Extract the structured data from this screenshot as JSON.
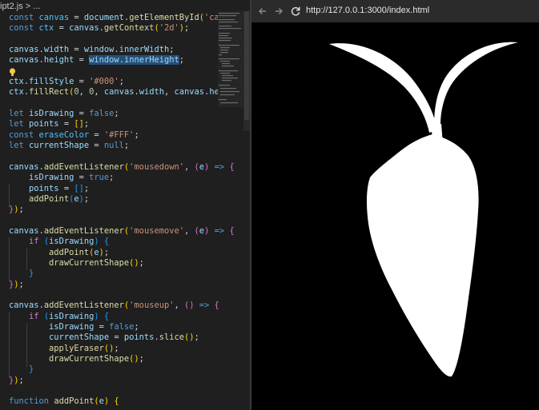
{
  "editor": {
    "breadcrumb": "ipt2.js > ...",
    "code_lines": [
      [
        [
          "kw",
          "const "
        ],
        [
          "cst",
          "canvas"
        ],
        [
          "pun",
          " = "
        ],
        [
          "var",
          "document"
        ],
        [
          "pun",
          "."
        ],
        [
          "fn",
          "getElementById"
        ],
        [
          "b1",
          "("
        ],
        [
          "str",
          "'canvas'"
        ],
        [
          "b1",
          ")"
        ],
        [
          "pun",
          ";"
        ]
      ],
      [
        [
          "kw",
          "const "
        ],
        [
          "cst",
          "ctx"
        ],
        [
          "pun",
          " = "
        ],
        [
          "var",
          "canvas"
        ],
        [
          "pun",
          "."
        ],
        [
          "fn",
          "getContext"
        ],
        [
          "b1",
          "("
        ],
        [
          "str",
          "'2d'"
        ],
        [
          "b1",
          ")"
        ],
        [
          "pun",
          ";"
        ]
      ],
      [],
      [
        [
          "var",
          "canvas"
        ],
        [
          "pun",
          "."
        ],
        [
          "var",
          "width"
        ],
        [
          "pun",
          " = "
        ],
        [
          "var",
          "window"
        ],
        [
          "pun",
          "."
        ],
        [
          "var",
          "innerWidth"
        ],
        [
          "pun",
          ";"
        ]
      ],
      [
        [
          "var",
          "canvas"
        ],
        [
          "pun",
          "."
        ],
        [
          "var",
          "height"
        ],
        [
          "pun",
          " = "
        ],
        [
          "var hl",
          "window"
        ],
        [
          "pun hl",
          "."
        ],
        [
          "var hl",
          "innerHeight"
        ],
        [
          "pun",
          ";"
        ]
      ],
      [],
      [
        [
          "var",
          "ctx"
        ],
        [
          "pun",
          "."
        ],
        [
          "var",
          "fillStyle"
        ],
        [
          "pun",
          " = "
        ],
        [
          "str",
          "'#000'"
        ],
        [
          "pun",
          ";"
        ]
      ],
      [
        [
          "var",
          "ctx"
        ],
        [
          "pun",
          "."
        ],
        [
          "fn",
          "fillRect"
        ],
        [
          "b1",
          "("
        ],
        [
          "num",
          "0"
        ],
        [
          "pun",
          ", "
        ],
        [
          "num",
          "0"
        ],
        [
          "pun",
          ", "
        ],
        [
          "var",
          "canvas"
        ],
        [
          "pun",
          "."
        ],
        [
          "var",
          "width"
        ],
        [
          "pun",
          ", "
        ],
        [
          "var",
          "canvas"
        ],
        [
          "pun",
          "."
        ],
        [
          "var",
          "height"
        ],
        [
          "b1",
          ")"
        ],
        [
          "pun",
          ";"
        ]
      ],
      [],
      [
        [
          "kw",
          "let "
        ],
        [
          "var",
          "isDrawing"
        ],
        [
          "pun",
          " = "
        ],
        [
          "kw",
          "false"
        ],
        [
          "pun",
          ";"
        ]
      ],
      [
        [
          "kw",
          "let "
        ],
        [
          "var",
          "points"
        ],
        [
          "pun",
          " = "
        ],
        [
          "b1",
          "[]"
        ],
        [
          "pun",
          ";"
        ]
      ],
      [
        [
          "kw",
          "const "
        ],
        [
          "cst",
          "eraseColor"
        ],
        [
          "pun",
          " = "
        ],
        [
          "str",
          "'#FFF'"
        ],
        [
          "pun",
          ";"
        ]
      ],
      [
        [
          "kw",
          "let "
        ],
        [
          "var",
          "currentShape"
        ],
        [
          "pun",
          " = "
        ],
        [
          "kw",
          "null"
        ],
        [
          "pun",
          ";"
        ]
      ],
      [],
      [
        [
          "var",
          "canvas"
        ],
        [
          "pun",
          "."
        ],
        [
          "fn",
          "addEventListener"
        ],
        [
          "b1",
          "("
        ],
        [
          "str",
          "'mousedown'"
        ],
        [
          "pun",
          ", "
        ],
        [
          "b2",
          "("
        ],
        [
          "var",
          "e"
        ],
        [
          "b2",
          ")"
        ],
        [
          "kw",
          " => "
        ],
        [
          "b2",
          "{"
        ]
      ],
      [
        [
          "pun",
          "    "
        ],
        [
          "var",
          "isDrawing"
        ],
        [
          "pun",
          " = "
        ],
        [
          "kw",
          "true"
        ],
        [
          "pun",
          ";"
        ]
      ],
      [
        [
          "pun",
          "    "
        ],
        [
          "var",
          "points"
        ],
        [
          "pun",
          " = "
        ],
        [
          "b3",
          "[]"
        ],
        [
          "pun",
          ";"
        ]
      ],
      [
        [
          "pun",
          "    "
        ],
        [
          "fn",
          "addPoint"
        ],
        [
          "b3",
          "("
        ],
        [
          "var",
          "e"
        ],
        [
          "b3",
          ")"
        ],
        [
          "pun",
          ";"
        ]
      ],
      [
        [
          "b2",
          "}"
        ],
        [
          "b1",
          ")"
        ],
        [
          "pun",
          ";"
        ]
      ],
      [],
      [
        [
          "var",
          "canvas"
        ],
        [
          "pun",
          "."
        ],
        [
          "fn",
          "addEventListener"
        ],
        [
          "b1",
          "("
        ],
        [
          "str",
          "'mousemove'"
        ],
        [
          "pun",
          ", "
        ],
        [
          "b2",
          "("
        ],
        [
          "var",
          "e"
        ],
        [
          "b2",
          ")"
        ],
        [
          "kw",
          " => "
        ],
        [
          "b2",
          "{"
        ]
      ],
      [
        [
          "pun",
          "    "
        ],
        [
          "ctl",
          "if "
        ],
        [
          "b3",
          "("
        ],
        [
          "var",
          "isDrawing"
        ],
        [
          "b3",
          ")"
        ],
        [
          "pun",
          " "
        ],
        [
          "b3",
          "{"
        ]
      ],
      [
        [
          "pun",
          "        "
        ],
        [
          "fn",
          "addPoint"
        ],
        [
          "b1",
          "("
        ],
        [
          "var",
          "e"
        ],
        [
          "b1",
          ")"
        ],
        [
          "pun",
          ";"
        ]
      ],
      [
        [
          "pun",
          "        "
        ],
        [
          "fn",
          "drawCurrentShape"
        ],
        [
          "b1",
          "()"
        ],
        [
          "pun",
          ";"
        ]
      ],
      [
        [
          "pun",
          "    "
        ],
        [
          "b3",
          "}"
        ]
      ],
      [
        [
          "b2",
          "}"
        ],
        [
          "b1",
          ")"
        ],
        [
          "pun",
          ";"
        ]
      ],
      [],
      [
        [
          "var",
          "canvas"
        ],
        [
          "pun",
          "."
        ],
        [
          "fn",
          "addEventListener"
        ],
        [
          "b1",
          "("
        ],
        [
          "str",
          "'mouseup'"
        ],
        [
          "pun",
          ", "
        ],
        [
          "b2",
          "()"
        ],
        [
          "kw",
          " => "
        ],
        [
          "b2",
          "{"
        ]
      ],
      [
        [
          "pun",
          "    "
        ],
        [
          "ctl",
          "if "
        ],
        [
          "b3",
          "("
        ],
        [
          "var",
          "isDrawing"
        ],
        [
          "b3",
          ")"
        ],
        [
          "pun",
          " "
        ],
        [
          "b3",
          "{"
        ]
      ],
      [
        [
          "pun",
          "        "
        ],
        [
          "var",
          "isDrawing"
        ],
        [
          "pun",
          " = "
        ],
        [
          "kw",
          "false"
        ],
        [
          "pun",
          ";"
        ]
      ],
      [
        [
          "pun",
          "        "
        ],
        [
          "var",
          "currentShape"
        ],
        [
          "pun",
          " = "
        ],
        [
          "var",
          "points"
        ],
        [
          "pun",
          "."
        ],
        [
          "fn",
          "slice"
        ],
        [
          "b1",
          "()"
        ],
        [
          "pun",
          ";"
        ]
      ],
      [
        [
          "pun",
          "        "
        ],
        [
          "fn",
          "applyEraser"
        ],
        [
          "b1",
          "()"
        ],
        [
          "pun",
          ";"
        ]
      ],
      [
        [
          "pun",
          "        "
        ],
        [
          "fn",
          "drawCurrentShape"
        ],
        [
          "b1",
          "()"
        ],
        [
          "pun",
          ";"
        ]
      ],
      [
        [
          "pun",
          "    "
        ],
        [
          "b3",
          "}"
        ]
      ],
      [
        [
          "b2",
          "}"
        ],
        [
          "b1",
          ")"
        ],
        [
          "pun",
          ";"
        ]
      ],
      [],
      [
        [
          "kw",
          "function "
        ],
        [
          "fn",
          "addPoint"
        ],
        [
          "b1",
          "("
        ],
        [
          "var",
          "e"
        ],
        [
          "b1",
          ")"
        ],
        [
          "pun",
          " "
        ],
        [
          "b1",
          "{"
        ]
      ]
    ],
    "lightbulb_icon": "lightbulb-icon"
  },
  "browser": {
    "back_icon": "arrow-left-icon",
    "forward_icon": "arrow-right-icon",
    "reload_icon": "reload-icon",
    "url": "http://127.0.0.1:3000/index.html",
    "canvas_background": "#000000",
    "shape_color": "#FFFFFF"
  }
}
